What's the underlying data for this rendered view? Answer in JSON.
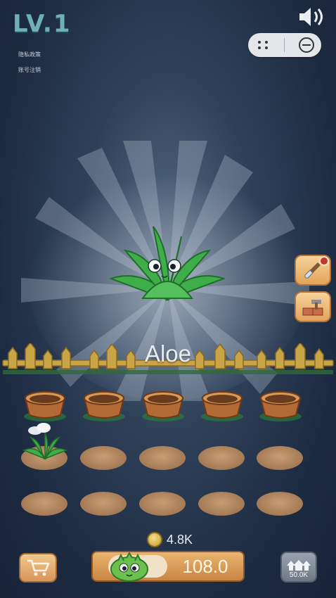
{
  "header": {
    "level": "LV.1",
    "link_privacy": "隐私政策",
    "link_account": "账号注销"
  },
  "icons": {
    "sound": "speaker-icon",
    "menu": "more-dots-icon",
    "close": "minimize-icon",
    "shovel": "shovel-icon",
    "tools": "hammer-brick-icon",
    "cart": "cart-icon",
    "upgrade": "upgrade-arrows-icon",
    "coin": "coin-icon"
  },
  "stage": {
    "plant_name": "Aloe"
  },
  "garden": {
    "rows": [
      [
        "pot",
        "pot",
        "pot",
        "pot",
        "pot"
      ],
      [
        "plant",
        "empty",
        "empty",
        "empty",
        "empty"
      ],
      [
        "empty",
        "empty",
        "empty",
        "empty",
        "empty"
      ]
    ]
  },
  "footer": {
    "coins": "4.8K",
    "buy_price": "108.0",
    "upgrade_cost": "50.0K"
  },
  "colors": {
    "accent": "#6fb0b6",
    "button_orange": "#e4a45a",
    "button_gray": "#7a8492"
  }
}
